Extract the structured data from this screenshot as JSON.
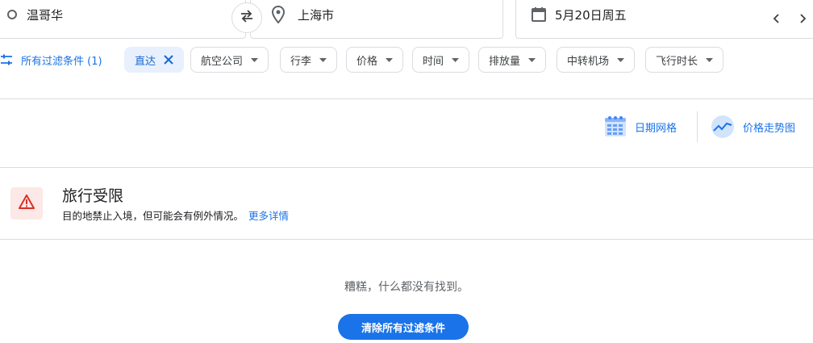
{
  "search": {
    "origin": "温哥华",
    "destination": "上海市",
    "date": "5月20日周五"
  },
  "filters": {
    "all_filters_label": "所有过滤条件 (1)",
    "active_chip": "直达",
    "chips": [
      "航空公司",
      "行李",
      "价格",
      "时间",
      "排放量",
      "中转机场",
      "飞行时长"
    ]
  },
  "tools": {
    "date_grid": "日期网格",
    "price_graph": "价格走势图"
  },
  "restriction": {
    "title": "旅行受限",
    "text": "目的地禁止入境，但可能会有例外情况。",
    "link": "更多详情"
  },
  "empty_state": {
    "message": "糟糕，什么都没有找到。",
    "clear_button": "清除所有过滤条件"
  },
  "colors": {
    "accent": "#1a73e8",
    "chip_active_bg": "#e8f0fe",
    "warning_bg": "#fce8e6",
    "warning_icon": "#d93025"
  }
}
